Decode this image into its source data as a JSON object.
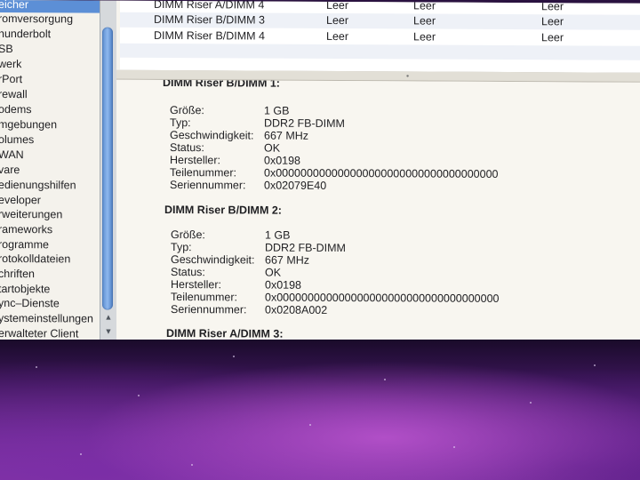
{
  "sidebar": {
    "items": [
      {
        "label": "eicher",
        "selected": true
      },
      {
        "label": "romversorgung"
      },
      {
        "label": "hunderbolt"
      },
      {
        "label": "SB"
      },
      {
        "label": "werk"
      },
      {
        "label": "rPort"
      },
      {
        "label": "rewall"
      },
      {
        "label": "odems"
      },
      {
        "label": "mgebungen"
      },
      {
        "label": "olumes"
      },
      {
        "label": "WAN"
      },
      {
        "label": "vare"
      },
      {
        "label": "edienungshilfen"
      },
      {
        "label": "eveloper"
      },
      {
        "label": "rweiterungen"
      },
      {
        "label": "rameworks"
      },
      {
        "label": "rogramme"
      },
      {
        "label": "rotokolldateien"
      },
      {
        "label": "chriften"
      },
      {
        "label": "tartobjekte"
      },
      {
        "label": "ync–Dienste"
      },
      {
        "label": "ystemeinstellungen"
      },
      {
        "label": "erwalteter Client"
      }
    ],
    "scroll_up_glyph": "▲",
    "scroll_down_glyph": "▼"
  },
  "table": {
    "rows": [
      {
        "name": "DIMM Riser A/DIMM 4",
        "col2": "Leer",
        "col3": "Leer",
        "col4": "Leer"
      },
      {
        "name": "DIMM Riser B/DIMM 3",
        "col2": "Leer",
        "col3": "Leer",
        "col4": "Leer"
      },
      {
        "name": "DIMM Riser B/DIMM 4",
        "col2": "Leer",
        "col3": "Leer",
        "col4": "Leer"
      }
    ]
  },
  "detail": {
    "sections": [
      {
        "heading": "DIMM Riser B/DIMM 1:",
        "fields": [
          {
            "key": "Größe:",
            "value": "1 GB"
          },
          {
            "key": "Typ:",
            "value": "DDR2 FB-DIMM"
          },
          {
            "key": "Geschwindigkeit:",
            "value": "667 MHz"
          },
          {
            "key": "Status:",
            "value": "OK"
          },
          {
            "key": "Hersteller:",
            "value": "0x0198"
          },
          {
            "key": "Teilenummer:",
            "value": "0x000000000000000000000000000000000000"
          },
          {
            "key": "Seriennummer:",
            "value": "0x02079E40"
          }
        ]
      },
      {
        "heading": "DIMM Riser B/DIMM 2:",
        "fields": [
          {
            "key": "Größe:",
            "value": "1 GB"
          },
          {
            "key": "Typ:",
            "value": "DDR2 FB-DIMM"
          },
          {
            "key": "Geschwindigkeit:",
            "value": "667 MHz"
          },
          {
            "key": "Status:",
            "value": "OK"
          },
          {
            "key": "Hersteller:",
            "value": "0x0198"
          },
          {
            "key": "Teilenummer:",
            "value": "0x000000000000000000000000000000000000"
          },
          {
            "key": "Seriennummer:",
            "value": "0x0208A002"
          }
        ]
      },
      {
        "heading": "DIMM Riser A/DIMM 3:",
        "fields": []
      }
    ]
  },
  "colors": {
    "selection": "#5c8fd6",
    "wallpaper": "#7b2ea6"
  }
}
